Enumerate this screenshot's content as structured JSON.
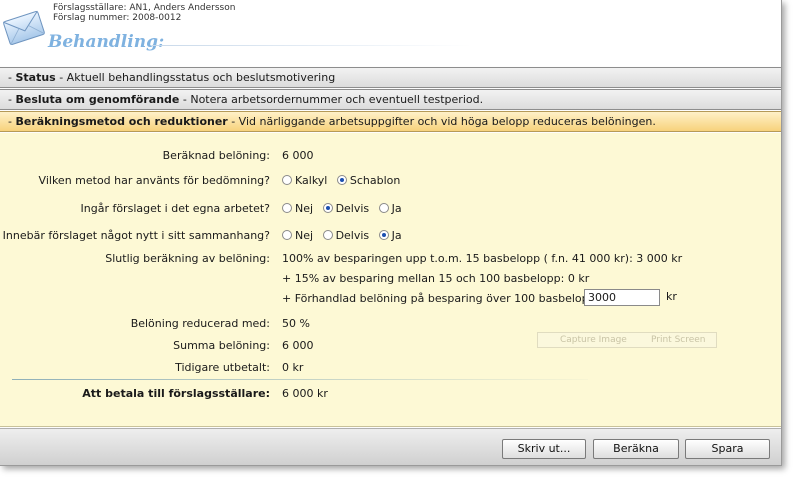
{
  "header": {
    "submitter": "Förslagsställare: AN1, Anders Andersson",
    "proposal_number": "Förslag nummer: 2008-0012",
    "section_title": "Behandling:"
  },
  "sections": [
    {
      "title": "Status",
      "desc": " - Aktuell behandlingsstatus och beslutsmotivering"
    },
    {
      "title": "Besluta om genomförande",
      "desc": " - Notera arbetsordernummer och eventuell testperiod."
    },
    {
      "title": "Beräkningsmetod och reduktioner",
      "desc": " - Vid närliggande arbetsuppgifter och vid höga belopp reduceras belöningen."
    }
  ],
  "form": {
    "calc_reward_label": "Beräknad belöning:",
    "calc_reward_value": "6 000",
    "method_label": "Vilken metod har använts för bedömning?",
    "method_options": [
      "Kalkyl",
      "Schablon"
    ],
    "method_selected": "Schablon",
    "own_work_label": "Ingår förslaget i det egna arbetet?",
    "own_work_options": [
      "Nej",
      "Delvis",
      "Ja"
    ],
    "own_work_selected": "Delvis",
    "new_label": "Innebär förslaget något nytt i sitt sammanhang?",
    "new_options": [
      "Nej",
      "Delvis",
      "Ja"
    ],
    "new_selected": "Ja",
    "final_calc_label": "Slutlig beräkning av belöning:",
    "final_line1": "100% av besparingen upp t.o.m. 15 basbelopp ( f.n.  41 000  kr): 3 000  kr",
    "final_line2": "+ 15% av besparing mellan 15 och 100 basbelopp:  0  kr",
    "final_line3": "+ Förhandlad belöning på besparing över 100 basbelopp:",
    "negotiated_value": "3000",
    "kr": "kr",
    "reduced_label": "Belöning reducerad med:",
    "reduced_value": "50 %",
    "sum_label": "Summa belöning:",
    "sum_value": "6 000",
    "paid_label": "Tidigare utbetalt:",
    "paid_value": "0 kr",
    "to_pay_label": "Att betala till förslagsställare:",
    "to_pay_value": "6 000 kr"
  },
  "capture": {
    "capture_image": "Capture Image",
    "print_screen": "Print Screen"
  },
  "buttons": {
    "print": "Skriv ut...",
    "calculate": "Beräkna",
    "save": "Spara"
  }
}
